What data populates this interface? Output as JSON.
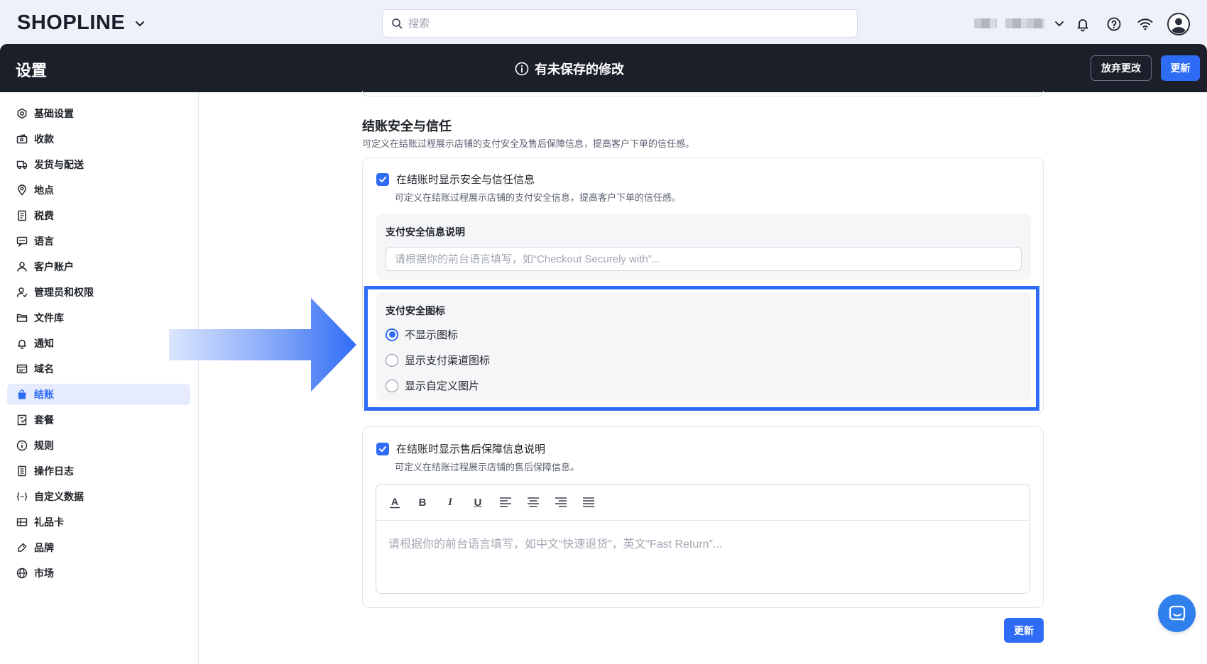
{
  "brand": {
    "name": "SHOPLINE"
  },
  "search": {
    "placeholder": "搜索"
  },
  "header": {
    "title": "设置",
    "notice": "有未保存的修改",
    "discard_label": "放弃更改",
    "update_label": "更新"
  },
  "sidebar": {
    "items": [
      {
        "label": "基础设置",
        "icon": "settings-icon"
      },
      {
        "label": "收款",
        "icon": "payment-icon"
      },
      {
        "label": "发货与配送",
        "icon": "truck-icon"
      },
      {
        "label": "地点",
        "icon": "location-icon"
      },
      {
        "label": "税费",
        "icon": "tax-icon"
      },
      {
        "label": "语言",
        "icon": "language-icon"
      },
      {
        "label": "客户账户",
        "icon": "user-icon"
      },
      {
        "label": "管理员和权限",
        "icon": "admin-icon"
      },
      {
        "label": "文件库",
        "icon": "folder-icon"
      },
      {
        "label": "通知",
        "icon": "bell-icon"
      },
      {
        "label": "域名",
        "icon": "domain-icon"
      },
      {
        "label": "结账",
        "icon": "bag-icon",
        "active": true
      },
      {
        "label": "套餐",
        "icon": "plan-icon"
      },
      {
        "label": "规则",
        "icon": "info-icon"
      },
      {
        "label": "操作日志",
        "icon": "log-icon"
      },
      {
        "label": "自定义数据",
        "icon": "code-icon"
      },
      {
        "label": "礼品卡",
        "icon": "giftcard-icon"
      },
      {
        "label": "品牌",
        "icon": "brand-icon"
      },
      {
        "label": "市场",
        "icon": "globe-icon"
      }
    ]
  },
  "section": {
    "title": "结账安全与信任",
    "desc": "可定义在结账过程展示店铺的支付安全及售后保障信息，提高客户下单的信任感。"
  },
  "trust": {
    "checkbox_label": "在结账时显示安全与信任信息",
    "checkbox_desc": "可定义在结账过程展示店铺的支付安全信息，提高客户下单的信任感。",
    "input_label": "支付安全信息说明",
    "input_placeholder": "请根据你的前台语言填写，如“Checkout Securely with”...",
    "icons_label": "支付安全图标",
    "options": [
      {
        "label": "不显示图标",
        "selected": true
      },
      {
        "label": "显示支付渠道图标",
        "selected": false
      },
      {
        "label": "显示自定义图片",
        "selected": false
      }
    ]
  },
  "aftersale": {
    "checkbox_label": "在结账时显示售后保障信息说明",
    "checkbox_desc": "可定义在结账过程展示店铺的售后保障信息。",
    "editor_placeholder": "请根据你的前台语言填写，如中文“快速退货”，英文“Fast Return”...",
    "toolbar": [
      "font-color-icon",
      "bold-icon",
      "italic-icon",
      "underline-icon",
      "align-left-icon",
      "align-center-icon",
      "align-right-icon",
      "align-justify-icon"
    ],
    "toolbar_letters": {
      "font_color": "A",
      "bold": "B",
      "italic": "I",
      "underline": "U"
    }
  },
  "footer": {
    "update_label": "更新"
  },
  "colors": {
    "accent": "#2f6cf6",
    "dark_header": "#1b1f2a",
    "topbar_bg": "#eef1fa"
  }
}
